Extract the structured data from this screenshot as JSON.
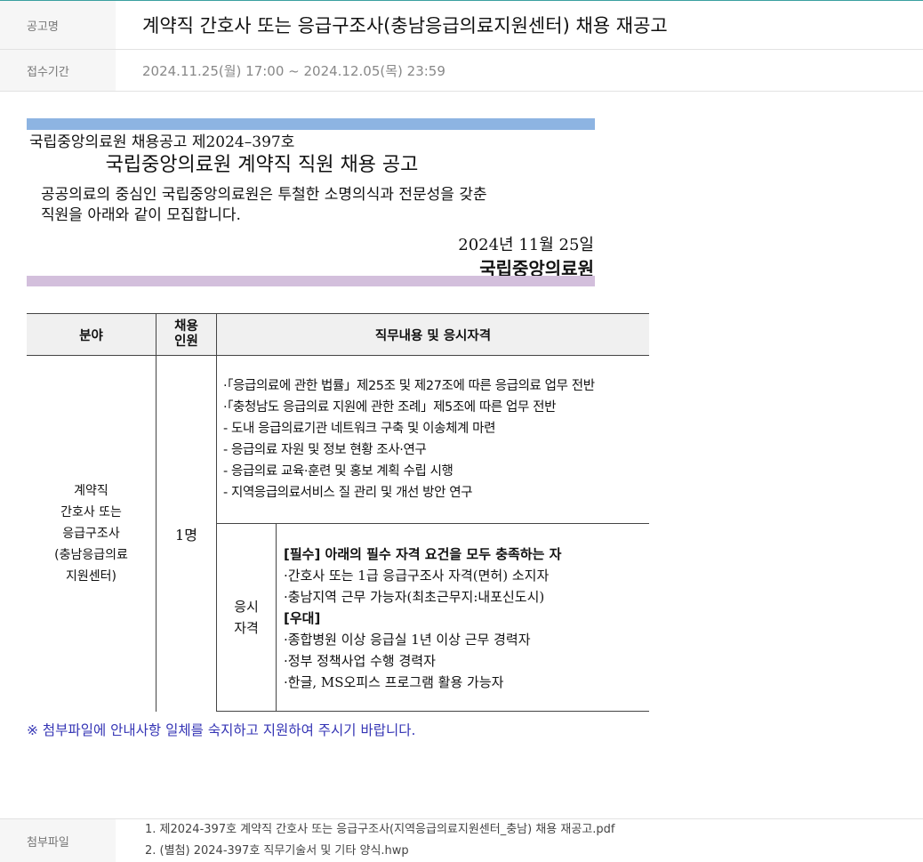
{
  "header": {
    "title_label": "공고명",
    "title": "계약직 간호사 또는 응급구조사(충남응급의료지원센터) 채용 재공고",
    "period_label": "접수기간",
    "period": "2024.11.25(월) 17:00 ~ 2024.12.05(목) 23:59"
  },
  "notice": {
    "number": "국립중앙의료원 채용공고 제2024–397호",
    "title": "국립중앙의료원 계약직 직원 채용 공고",
    "body_line1": "공공의료의 중심인 국립중앙의료원은 투철한 소명의식과 전문성을 갖춘",
    "body_line2": "직원을 아래와 같이 모집합니다.",
    "date": "2024년 11월 25일",
    "org": "국립중앙의료원",
    "colors": {
      "top_bar": "#8db4e2",
      "bottom_bar": "#d3bfdc"
    }
  },
  "table": {
    "headers": {
      "field": "분야",
      "count_line1": "채용",
      "count_line2": "인원",
      "duties": "직무내용 및 응시자격"
    },
    "field_lines": [
      "계약직",
      "간호사 또는",
      "응급구조사",
      "(충남응급의료",
      "지원센터)"
    ],
    "count": "1명",
    "duties": [
      "·「응급의료에 관한 법률」제25조 및 제27조에 따른 응급의료 업무 전반",
      "·「충청남도 응급의료 지원에 관한 조례」제5조에 따른 업무 전반",
      "- 도내 응급의료기관 네트워크 구축 및 이송체계 마련",
      "- 응급의료 자원 및 정보 현황 조사·연구",
      "- 응급의료 교육·훈련 및 홍보 계획 수립 시행",
      "- 지역응급의료서비스 질 관리 및 개선 방안 연구"
    ],
    "qual_label_line1": "응시",
    "qual_label_line2": "자격",
    "required_heading": "[필수] 아래의 필수 자격 요건을 모두 충족하는 자",
    "required": [
      "·간호사 또는 1급 응급구조사 자격(면허) 소지자",
      "·충남지역 근무 가능자(최초근무지:내포신도시)"
    ],
    "preferred_heading": "[우대]",
    "preferred": [
      "·종합병원 이상 응급실 1년 이상 근무 경력자",
      "·정부 정책사업 수행 경력자",
      "·한글, MS오피스 프로그램 활용 가능자"
    ]
  },
  "note": "※ 첨부파일에 안내사항 일체를 숙지하고 지원하여 주시기 바랍니다.",
  "attachments": {
    "label": "첨부파일",
    "files": [
      "1. 제2024-397호 계약직 간호사 또는 응급구조사(지역응급의료지원센터_충남) 채용 재공고.pdf",
      "2. (별첨) 2024-397호 직무기술서 및 기타 양식.hwp"
    ]
  }
}
